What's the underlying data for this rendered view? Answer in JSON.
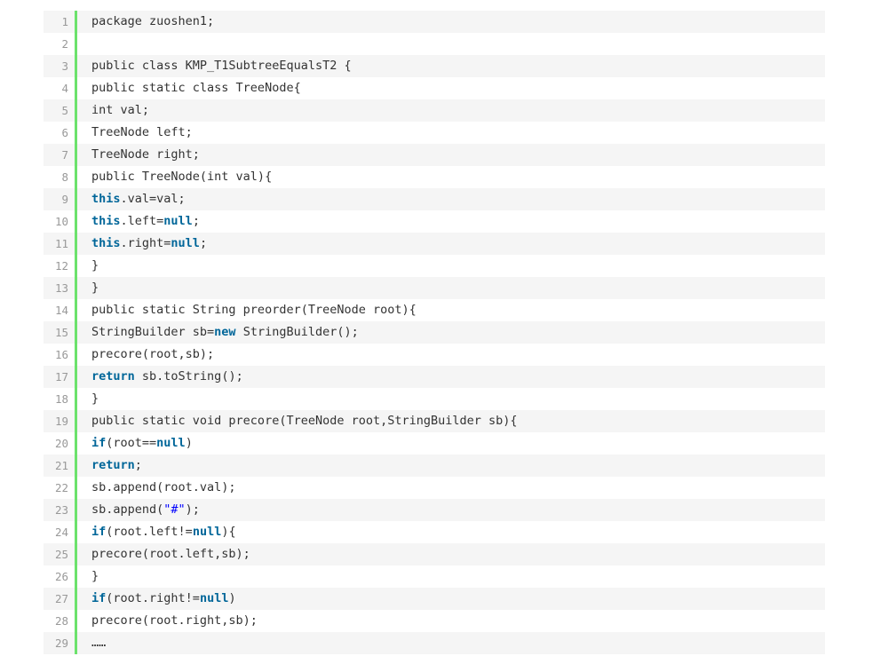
{
  "lines": [
    {
      "n": "1",
      "t": [
        {
          "c": "package zuoshen1;"
        }
      ]
    },
    {
      "n": "2",
      "t": []
    },
    {
      "n": "3",
      "t": [
        {
          "c": "public class KMP_T1SubtreeEqualsT2 {"
        }
      ]
    },
    {
      "n": "4",
      "t": [
        {
          "c": "public static class TreeNode{"
        }
      ]
    },
    {
      "n": "5",
      "t": [
        {
          "c": "int val;"
        }
      ]
    },
    {
      "n": "6",
      "t": [
        {
          "c": "TreeNode left;"
        }
      ]
    },
    {
      "n": "7",
      "t": [
        {
          "c": "TreeNode right;"
        }
      ]
    },
    {
      "n": "8",
      "t": [
        {
          "c": "public TreeNode(int val){"
        }
      ]
    },
    {
      "n": "9",
      "t": [
        {
          "c": "this",
          "k": "kw"
        },
        {
          "c": ".val=val;"
        }
      ]
    },
    {
      "n": "10",
      "t": [
        {
          "c": "this",
          "k": "kw"
        },
        {
          "c": ".left="
        },
        {
          "c": "null",
          "k": "kw"
        },
        {
          "c": ";"
        }
      ]
    },
    {
      "n": "11",
      "t": [
        {
          "c": "this",
          "k": "kw"
        },
        {
          "c": ".right="
        },
        {
          "c": "null",
          "k": "kw"
        },
        {
          "c": ";"
        }
      ]
    },
    {
      "n": "12",
      "t": [
        {
          "c": "}"
        }
      ]
    },
    {
      "n": "13",
      "t": [
        {
          "c": "}"
        }
      ]
    },
    {
      "n": "14",
      "t": [
        {
          "c": "public static String preorder(TreeNode root){"
        }
      ]
    },
    {
      "n": "15",
      "t": [
        {
          "c": "StringBuilder sb="
        },
        {
          "c": "new",
          "k": "kw"
        },
        {
          "c": " StringBuilder();"
        }
      ]
    },
    {
      "n": "16",
      "t": [
        {
          "c": "precore(root,sb);"
        }
      ]
    },
    {
      "n": "17",
      "t": [
        {
          "c": "return",
          "k": "kw"
        },
        {
          "c": " sb.toString();"
        }
      ]
    },
    {
      "n": "18",
      "t": [
        {
          "c": "}"
        }
      ]
    },
    {
      "n": "19",
      "t": [
        {
          "c": "public static void precore(TreeNode root,StringBuilder sb){"
        }
      ]
    },
    {
      "n": "20",
      "t": [
        {
          "c": "if",
          "k": "kw"
        },
        {
          "c": "(root=="
        },
        {
          "c": "null",
          "k": "kw"
        },
        {
          "c": ")"
        }
      ]
    },
    {
      "n": "21",
      "t": [
        {
          "c": "return",
          "k": "kw"
        },
        {
          "c": ";"
        }
      ]
    },
    {
      "n": "22",
      "t": [
        {
          "c": "sb.append(root.val);"
        }
      ]
    },
    {
      "n": "23",
      "t": [
        {
          "c": "sb.append("
        },
        {
          "c": "\"#\"",
          "k": "str"
        },
        {
          "c": ");"
        }
      ]
    },
    {
      "n": "24",
      "t": [
        {
          "c": "if",
          "k": "kw"
        },
        {
          "c": "(root.left!="
        },
        {
          "c": "null",
          "k": "kw"
        },
        {
          "c": "){"
        }
      ]
    },
    {
      "n": "25",
      "t": [
        {
          "c": "precore(root.left,sb);"
        }
      ]
    },
    {
      "n": "26",
      "t": [
        {
          "c": "}"
        }
      ]
    },
    {
      "n": "27",
      "t": [
        {
          "c": "if",
          "k": "kw"
        },
        {
          "c": "(root.right!="
        },
        {
          "c": "null",
          "k": "kw"
        },
        {
          "c": ")"
        }
      ]
    },
    {
      "n": "28",
      "t": [
        {
          "c": "precore(root.right,sb);"
        }
      ]
    },
    {
      "n": "29",
      "t": [
        {
          "c": "……"
        }
      ]
    }
  ]
}
